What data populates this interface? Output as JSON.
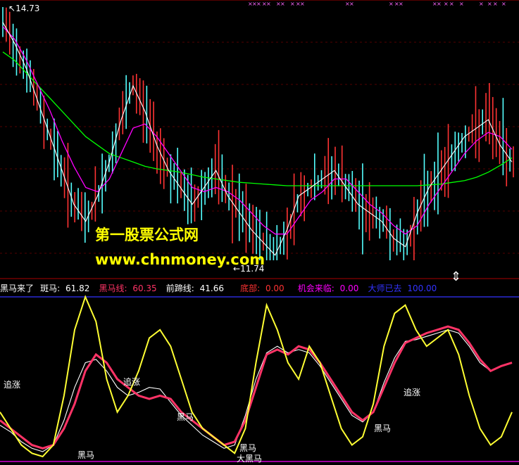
{
  "upper_panel": {
    "high_marker": "14.73",
    "low_marker": "11.74",
    "watermark_title": "第一股票公式网",
    "watermark_url": "www.chnmoney.com"
  },
  "indicator_bar": {
    "name": "黑马来了",
    "items": [
      {
        "label": "斑马:",
        "value": "61.82",
        "color": "#ffffff"
      },
      {
        "label": "黑马线:",
        "value": "60.35",
        "color": "#ff3366"
      },
      {
        "label": "前蹄线:",
        "value": "41.66",
        "color": "#ffffff"
      },
      {
        "label": "底部:",
        "value": "0.00",
        "color": "#ff3333"
      },
      {
        "label": "机会来临:",
        "value": "0.00",
        "color": "#ff00ff"
      },
      {
        "label": "大师已去",
        "value": "100.00",
        "color": "#3333ff"
      }
    ]
  },
  "signals": [
    {
      "text": "追涨"
    },
    {
      "text": "追涨"
    },
    {
      "text": "黑马"
    },
    {
      "text": "黑马"
    },
    {
      "text": "黑马"
    },
    {
      "text": "大黑马"
    },
    {
      "text": "黑马"
    },
    {
      "text": "追涨"
    }
  ],
  "chart_data": {
    "type": "line",
    "colors": {
      "candle_up": "#ff3333",
      "candle_down": "#54ffff",
      "ma_short": "#ffffff",
      "ma_mid": "#ff00ff",
      "ma_long": "#00ff00",
      "osc_yellow": "#ffff33",
      "osc_red": "#ff3366",
      "osc_white": "#ffffff"
    },
    "price_range": [
      11.74,
      14.73
    ],
    "price_series": {
      "name": "price",
      "values": [
        14.55,
        14.3,
        14.0,
        13.6,
        13.2,
        12.8,
        12.4,
        12.2,
        12.5,
        12.9,
        13.4,
        13.8,
        13.5,
        13.1,
        12.8,
        12.6,
        12.4,
        12.6,
        12.8,
        12.5,
        12.3,
        12.1,
        11.95,
        11.8,
        12.1,
        12.5,
        12.6,
        12.7,
        12.8,
        12.6,
        12.4,
        12.3,
        12.2,
        12.0,
        11.9,
        12.3,
        12.6,
        12.8,
        13.0,
        13.2,
        13.3,
        13.4,
        13.1,
        12.9
      ]
    },
    "ma_long": [
      14.2,
      14.1,
      13.95,
      13.8,
      13.65,
      13.5,
      13.35,
      13.2,
      13.1,
      13.0,
      12.95,
      12.9,
      12.85,
      12.82,
      12.8,
      12.78,
      12.75,
      12.72,
      12.7,
      12.68,
      12.66,
      12.65,
      12.64,
      12.63,
      12.62,
      12.62,
      12.62,
      12.62,
      12.62,
      12.62,
      12.62,
      12.62,
      12.62,
      12.62,
      12.62,
      12.62,
      12.63,
      12.64,
      12.66,
      12.68,
      12.72,
      12.78,
      12.86,
      12.95
    ],
    "ma_mid": [
      14.5,
      14.35,
      14.1,
      13.8,
      13.5,
      13.15,
      12.85,
      12.6,
      12.55,
      12.7,
      13.0,
      13.3,
      13.35,
      13.2,
      13.0,
      12.8,
      12.6,
      12.55,
      12.6,
      12.55,
      12.45,
      12.3,
      12.15,
      12.05,
      12.05,
      12.25,
      12.45,
      12.55,
      12.7,
      12.7,
      12.55,
      12.4,
      12.3,
      12.15,
      12.05,
      12.15,
      12.4,
      12.6,
      12.8,
      13.0,
      13.15,
      13.25,
      13.2,
      13.05
    ],
    "oscillator": {
      "range": [
        0,
        100
      ],
      "yellow": [
        30,
        20,
        10,
        5,
        3,
        10,
        40,
        80,
        100,
        85,
        50,
        30,
        40,
        55,
        75,
        80,
        70,
        50,
        30,
        20,
        15,
        10,
        5,
        20,
        60,
        95,
        80,
        60,
        50,
        70,
        60,
        40,
        20,
        10,
        15,
        35,
        70,
        90,
        95,
        80,
        70,
        75,
        80,
        65,
        40,
        20,
        10,
        15,
        30
      ],
      "red": [
        25,
        20,
        15,
        10,
        8,
        10,
        20,
        35,
        55,
        65,
        60,
        50,
        45,
        40,
        38,
        40,
        38,
        30,
        25,
        20,
        15,
        10,
        12,
        25,
        45,
        65,
        68,
        65,
        70,
        68,
        60,
        50,
        40,
        30,
        25,
        30,
        45,
        60,
        72,
        75,
        78,
        80,
        82,
        80,
        72,
        62,
        55,
        58,
        60
      ],
      "white": [
        22,
        18,
        12,
        8,
        6,
        10,
        25,
        45,
        60,
        62,
        55,
        45,
        40,
        42,
        45,
        44,
        36,
        28,
        22,
        16,
        12,
        8,
        10,
        28,
        50,
        66,
        70,
        66,
        68,
        66,
        58,
        48,
        38,
        28,
        24,
        30,
        48,
        63,
        73,
        74,
        76,
        78,
        80,
        78,
        70,
        60,
        55,
        58,
        60
      ]
    }
  }
}
